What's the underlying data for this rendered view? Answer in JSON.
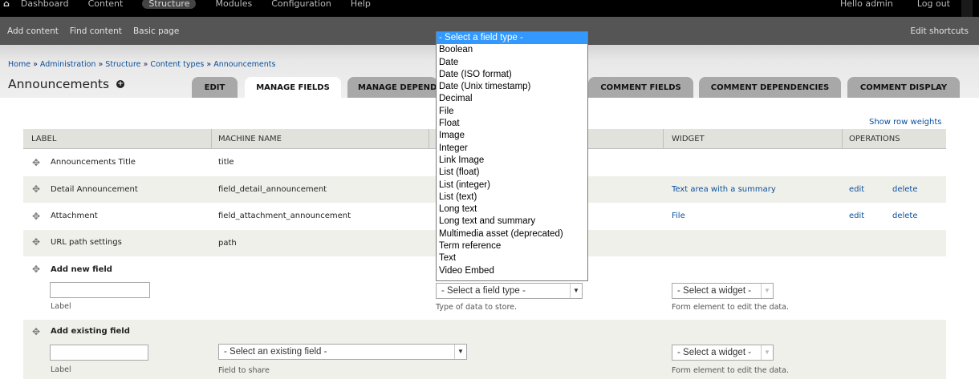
{
  "toolbar": {
    "menu": [
      "Dashboard",
      "Content",
      "Structure",
      "Modules",
      "Configuration",
      "Help"
    ],
    "user": "Hello admin",
    "logout": "Log out"
  },
  "shortcuts": {
    "items": [
      "Add content",
      "Find content",
      "Basic page"
    ],
    "edit": "Edit shortcuts"
  },
  "breadcrumb": {
    "items": [
      "Home",
      "Administration",
      "Structure",
      "Content types",
      "Announcements"
    ]
  },
  "page": {
    "title": "Announcements",
    "add_icon": "plus-circle-icon"
  },
  "tabs": [
    "EDIT",
    "MANAGE FIELDS",
    "MANAGE DEPENDENCIES",
    "COMMENT FIELDS",
    "COMMENT DEPENDENCIES",
    "COMMENT DISPLAY"
  ],
  "table": {
    "show_weights": "Show row weights",
    "headers": [
      "LABEL",
      "MACHINE NAME",
      "WIDGET",
      "OPERATIONS"
    ],
    "rows": [
      {
        "label": "Announcements Title",
        "machine": "title",
        "widget": "",
        "edit": "",
        "delete": ""
      },
      {
        "label": "Detail Announcement",
        "machine": "field_detail_announcement",
        "widget": "Text area with a summary",
        "edit": "edit",
        "delete": "delete"
      },
      {
        "label": "Attachment",
        "machine": "field_attachment_announcement",
        "widget": "File",
        "edit": "edit",
        "delete": "delete"
      },
      {
        "label": "URL path settings",
        "machine": "path",
        "widget": "",
        "edit": "",
        "delete": ""
      }
    ],
    "add_new": {
      "title": "Add new field",
      "label_hint": "Label",
      "field_type_value": "- Select a field type -",
      "field_type_hint": "Type of data to store.",
      "widget_value": "- Select a widget -",
      "widget_hint": "Form element to edit the data."
    },
    "add_existing": {
      "title": "Add existing field",
      "label_hint": "Label",
      "existing_value": "- Select an existing field -",
      "existing_hint": "Field to share",
      "widget_value": "- Select a widget -",
      "widget_hint": "Form element to edit the data."
    }
  },
  "dropdown": {
    "options": [
      "- Select a field type -",
      "Boolean",
      "Date",
      "Date (ISO format)",
      "Date (Unix timestamp)",
      "Decimal",
      "File",
      "Float",
      "Image",
      "Integer",
      "Link Image",
      "List (float)",
      "List (integer)",
      "List (text)",
      "Long text",
      "Long text and summary",
      "Multimedia asset (deprecated)",
      "Term reference",
      "Text",
      "Video Embed"
    ],
    "selected_index": 0
  }
}
